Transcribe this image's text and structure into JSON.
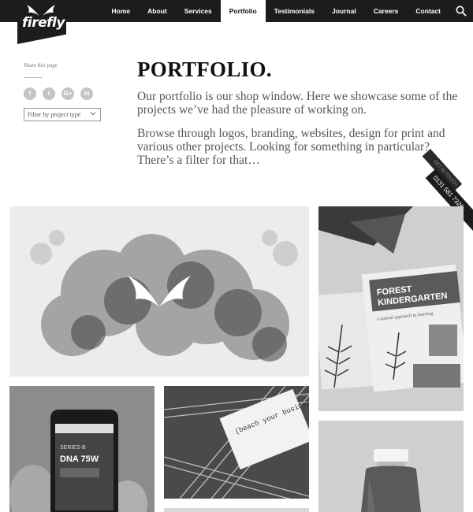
{
  "brand": {
    "name": "firefly"
  },
  "nav": {
    "items": [
      {
        "label": "Home",
        "active": false
      },
      {
        "label": "About",
        "active": false
      },
      {
        "label": "Services",
        "active": false
      },
      {
        "label": "Portfolio",
        "active": true
      },
      {
        "label": "Testimonials",
        "active": false
      },
      {
        "label": "Journal",
        "active": false
      },
      {
        "label": "Careers",
        "active": false
      },
      {
        "label": "Contact",
        "active": false
      }
    ],
    "search_icon": "search-icon"
  },
  "sidebar": {
    "share_label": "Share this page",
    "socials": [
      {
        "icon": "facebook-icon",
        "glyph": "f"
      },
      {
        "icon": "twitter-icon",
        "glyph": "t"
      },
      {
        "icon": "google-plus-icon",
        "glyph": "G+"
      },
      {
        "icon": "linkedin-icon",
        "glyph": "in"
      }
    ],
    "filter_label": "Filter by project type"
  },
  "main": {
    "title": "PORTFOLIO.",
    "intro": "Our portfolio is our shop window. Here we showcase some of the projects we’ve had the pleasure of working on.",
    "intro2": "Browse through logos, branding, websites, design for print and various other projects. Looking for something in particular? There’s a filter for that…"
  },
  "ribbon": {
    "tab_label": "GET IN TOUCH",
    "phone": "0131 581 7326"
  },
  "tiles": {
    "cards_text": "(beach your business to code)",
    "phone_text_1": "SERIES-B",
    "phone_text_2": "DNA 75W",
    "forest_title_1": "FOREST",
    "forest_title_2": "KINDERGARTEN",
    "forest_sub": "a natural approach to learning"
  },
  "colors": {
    "nav_bg": "#1c1c1c",
    "accent": "#ffffff"
  }
}
